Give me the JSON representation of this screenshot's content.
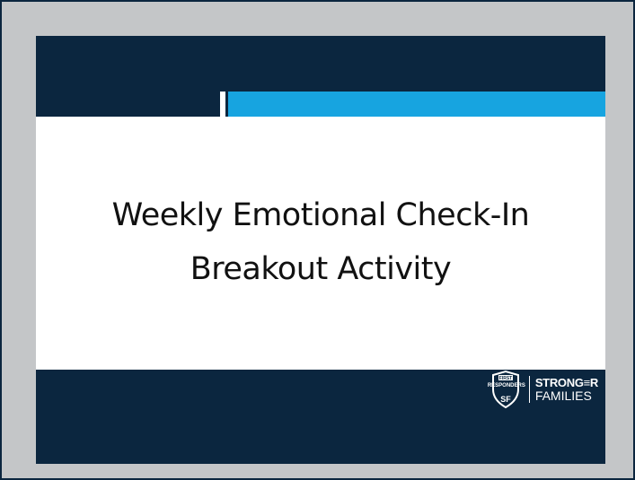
{
  "slide": {
    "title_line1": "Weekly Emotional Check-In",
    "title_line2": "Breakout Activity"
  },
  "logo": {
    "badge_text": "RESPONDERS",
    "badge_top": "FIRST",
    "badge_bottom": "SF",
    "word1": "STRONG≡R",
    "word2": "FAMILIES"
  },
  "colors": {
    "navy": "#0b263f",
    "accent_blue": "#17a4e0",
    "frame_gray": "#c4c6c8"
  }
}
